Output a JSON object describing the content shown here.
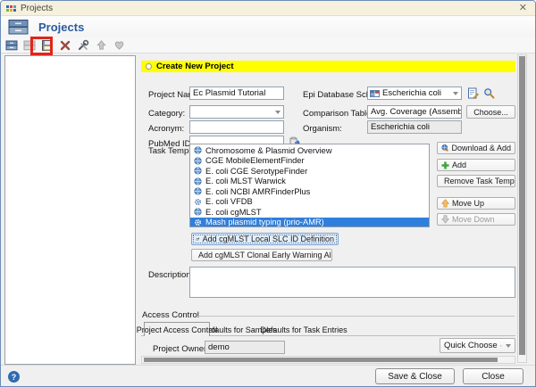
{
  "window": {
    "title": "Projects",
    "close_glyph": "✕"
  },
  "header": {
    "title": "Projects"
  },
  "toolbar": {
    "annotation_color": "#e2231a",
    "buttons": [
      {
        "name": "new-project",
        "enabled": true
      },
      {
        "name": "open-project",
        "enabled": false
      },
      {
        "name": "save-project",
        "enabled": true,
        "annotated": true
      },
      {
        "name": "delete-project",
        "enabled": true
      },
      {
        "name": "tools",
        "enabled": true
      },
      {
        "name": "publish",
        "enabled": false
      },
      {
        "name": "favorites",
        "enabled": false
      }
    ]
  },
  "icons": {
    "window-logo-icon": "colored-grid",
    "projects-app-icon": "drawer-cabinet",
    "save-icon": "floppy-disk",
    "delete-icon": "red-x",
    "tools-icon": "wrench",
    "scheme-grid-icon": "mini-table",
    "edit-scheme-icon": "page-pencil",
    "search-scheme-icon": "magnifier",
    "paste-icon": "clipboard-arrow",
    "globe-task-icon": "globe",
    "gear-task-icon": "gear",
    "download-globe-icon": "globe-down-arrow",
    "plus-icon": "green-plus",
    "minus-icon": "red-minus",
    "arrow-up-icon": "orange-up-arrow",
    "arrow-down-icon": "gray-down-arrow",
    "key-icon": "yellow-key",
    "help-icon": "blue-question"
  },
  "create_panel": {
    "banner": "Create New Project",
    "banner_color": "#ffff00",
    "fields": {
      "project_name": {
        "label": "Project Name:",
        "value": "Ec Plasmid Tutorial"
      },
      "category": {
        "label": "Category:",
        "value": ""
      },
      "acronym": {
        "label": "Acronym:",
        "value": ""
      },
      "pubmed_id": {
        "label": "PubMed ID:",
        "value": ""
      },
      "epi_database_scheme": {
        "label": "Epi Database Scheme:",
        "value": "Escherichia coli"
      },
      "comparison_table_fields": {
        "label": "Comparison Table Fields:",
        "value": "Avg. Coverage (Assembled), Approximated Ger",
        "choose_button": "Choose..."
      },
      "organism": {
        "label": "Organism:",
        "value": "Escherichia coli"
      }
    },
    "task_templates": {
      "label": "Task Templates:",
      "items": [
        {
          "label": "Chromosome & Plasmid Overview",
          "icon": "globe-task-icon",
          "selected": false
        },
        {
          "label": "CGE MobileElementFinder",
          "icon": "globe-task-icon",
          "selected": false
        },
        {
          "label": "E. coli CGE SerotypeFinder",
          "icon": "globe-task-icon",
          "selected": false
        },
        {
          "label": "E. coli MLST Warwick",
          "icon": "globe-task-icon",
          "selected": false
        },
        {
          "label": "E. coli NCBI AMRFinderPlus",
          "icon": "globe-task-icon",
          "selected": false
        },
        {
          "label": "E. coli VFDB",
          "icon": "gear-task-icon",
          "selected": false
        },
        {
          "label": "E. coli cgMLST",
          "icon": "globe-task-icon",
          "selected": false
        },
        {
          "label": "Mash plasmid typing (prio-AMR)",
          "icon": "gear-task-icon",
          "selected": true
        }
      ]
    },
    "template_buttons": [
      {
        "label": "Download & Add",
        "icon": "download-globe-icon",
        "enabled": true
      },
      {
        "label": "Add",
        "icon": "plus-icon",
        "enabled": true
      },
      {
        "label": "Remove Task Template",
        "icon": "minus-icon",
        "enabled": true
      },
      {
        "label": "Move Up",
        "icon": "arrow-up-icon",
        "enabled": true
      },
      {
        "label": "Move Down",
        "icon": "arrow-down-icon",
        "enabled": false
      }
    ],
    "cgmlst_buttons": [
      {
        "label": "Add cgMLST Local SLC ID Definition",
        "focused": true
      },
      {
        "label": "Add cgMLST Clonal Early Warning Alert Definitio...",
        "focused": false
      }
    ],
    "description": {
      "label": "Description:",
      "value": ""
    },
    "access_control": {
      "title": "Access Control",
      "tabs": [
        {
          "label": "Project Access Control",
          "active": true
        },
        {
          "label": "Defaults for Samples",
          "active": false
        },
        {
          "label": "Defaults for Task Entries",
          "active": false
        }
      ],
      "project_owner": {
        "label": "Project Owner:",
        "value": "demo"
      },
      "quick_choose_label": "Quick Choose"
    }
  },
  "footer": {
    "save_close": "Save & Close",
    "close": "Close"
  }
}
